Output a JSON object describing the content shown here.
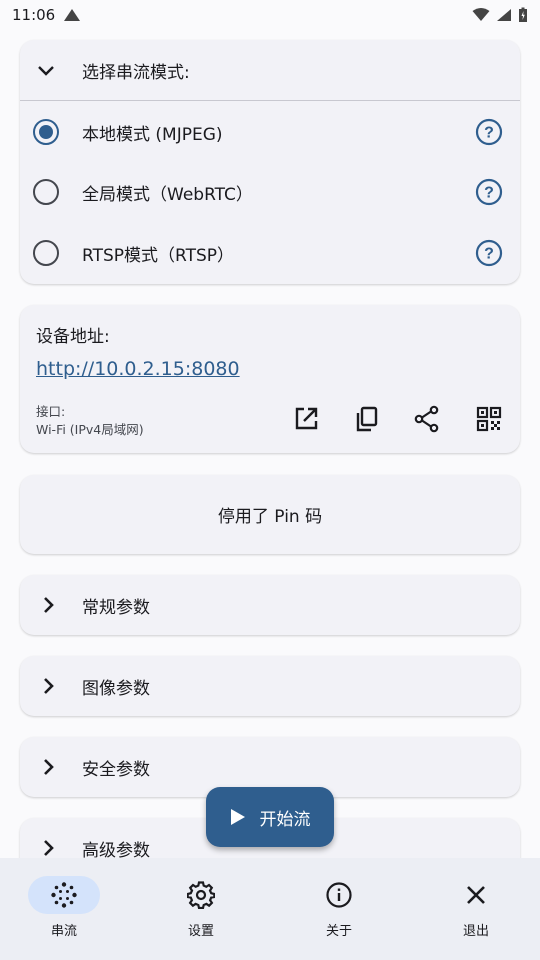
{
  "status_bar": {
    "time": "11:06"
  },
  "mode_selector": {
    "title": "选择串流模式:",
    "options": [
      {
        "label": "本地模式 (MJPEG)",
        "selected": true
      },
      {
        "label": "全局模式（WebRTC）",
        "selected": false
      },
      {
        "label": "RTSP模式（RTSP）",
        "selected": false
      }
    ]
  },
  "device_address": {
    "title": "设备地址:",
    "url": "http://10.0.2.15:8080",
    "interface_label": "接口:",
    "interface_value": "Wi-Fi (IPv4局域网)",
    "actions": [
      "open-external-icon",
      "copy-icon",
      "share-icon",
      "qr-code-icon"
    ]
  },
  "pin": {
    "text": "停用了 Pin 码"
  },
  "sections": [
    {
      "label": "常规参数"
    },
    {
      "label": "图像参数"
    },
    {
      "label": "安全参数"
    },
    {
      "label": "高级参数"
    }
  ],
  "fab": {
    "label": "开始流"
  },
  "bottom_nav": {
    "items": [
      {
        "label": "串流",
        "icon": "stream-icon",
        "active": true
      },
      {
        "label": "设置",
        "icon": "settings-icon",
        "active": false
      },
      {
        "label": "关于",
        "icon": "info-icon",
        "active": false
      },
      {
        "label": "退出",
        "icon": "close-icon",
        "active": false
      }
    ]
  },
  "colors": {
    "accent": "#2f5e8e",
    "card": "#f2f2f7",
    "nav": "#eceef4",
    "nav_active": "#d4e3fb"
  }
}
